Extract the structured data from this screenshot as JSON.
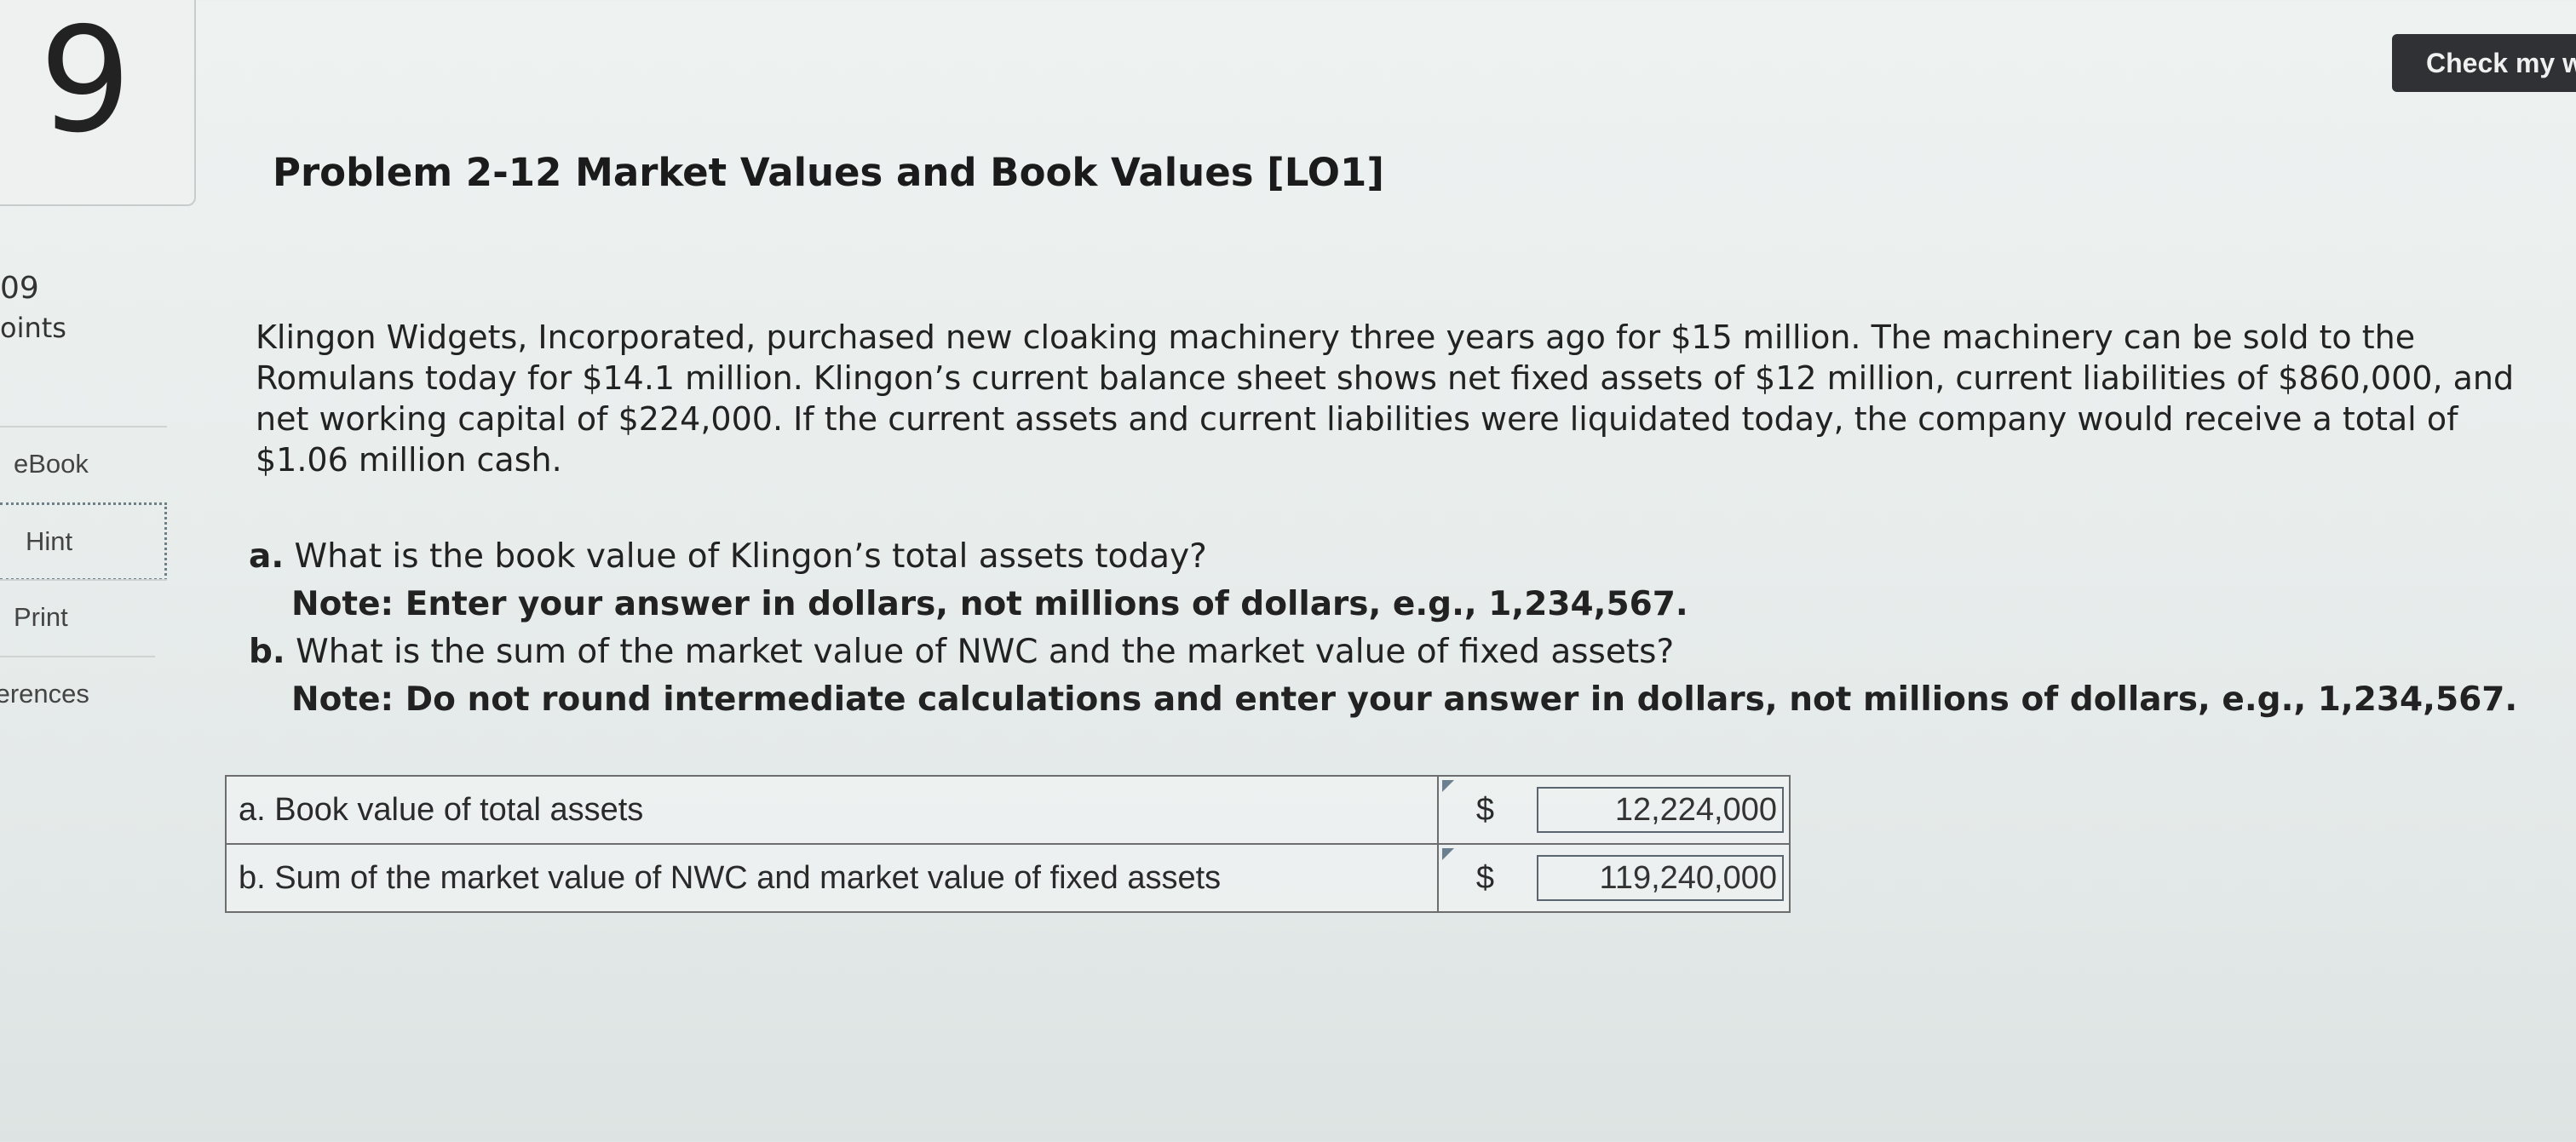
{
  "question": {
    "number": "9",
    "points_value": "09",
    "points_label": "oints"
  },
  "sidebar": {
    "items": [
      {
        "label": "eBook"
      },
      {
        "label": "Hint"
      },
      {
        "label": "Print"
      },
      {
        "label": "ferences"
      }
    ]
  },
  "toolbar": {
    "check_label": "Check my w"
  },
  "problem": {
    "title": "Problem 2-12 Market Values and Book Values [LO1]",
    "text": "Klingon Widgets, Incorporated, purchased new cloaking machinery three years ago for $15 million. The machinery can be sold to the Romulans today for $14.1 million. Klingon’s current balance sheet shows net fixed assets of $12 million, current liabilities of $860,000, and net working capital of $224,000. If the current assets and current liabilities were liquidated today, the company would receive a total of $1.06 million cash."
  },
  "questions": {
    "a_letter": "a.",
    "a_text": "What is the book value of Klingon’s total assets today?",
    "a_note": "Note: Enter your answer in dollars, not millions of dollars, e.g., 1,234,567.",
    "b_letter": "b.",
    "b_text": "What is the sum of the market value of NWC and the market value of fixed assets?",
    "b_note": "Note: Do not round intermediate calculations and enter your answer in dollars, not millions of dollars, e.g., 1,234,567."
  },
  "answers": {
    "rows": [
      {
        "label": "a. Book value of total assets",
        "currency": "$",
        "value": "12,224,000"
      },
      {
        "label": "b. Sum of the market value of NWC and market value of fixed assets",
        "currency": "$",
        "value": "119,240,000"
      }
    ]
  }
}
